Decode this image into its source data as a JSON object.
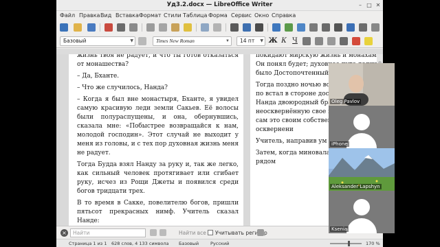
{
  "window": {
    "title": "Уд3.2.docx — LibreOffice Writer"
  },
  "menu": [
    "Файл",
    "Правка",
    "Вид",
    "Вставка",
    "Формат",
    "Стили",
    "Таблица",
    "Форма",
    "Сервис",
    "Окно",
    "Справка"
  ],
  "toolbar": {
    "paragraph_style": "Базовый",
    "font_name": "Times New Roman",
    "font_size": "14 пт",
    "bold_label": "Ж",
    "italic_label": "К",
    "underline_label": "Ч"
  },
  "document": {
    "page1": [
      "жизнь твоя не радует, и что ты готов отказаться от монашества?",
      "– Да, Бханте.",
      "– Что же случилось, Нанда?",
      "– Когда я был вне монастыря, Бханте, я увидел самую красивую леди земли Сакьев. Её волосы были полураспущены, и она, обернувшись, сказала мне: «Побыстрее возвращайся к нам, молодой господин». Этот случай не выходит у меня из головы, и с тех пор духовная жизнь меня не радует.",
      "Тогда Будда взял Нанду за руку и, так же легко, как сильный человек протягивает или сгибает руку, исчез из Рощи Джеты и появился среди богов тридцати трех.",
      "В то время в Сакке, повелителю богов, пришли пятьсот прекрасных нимф. Учитель сказал Нанде:"
    ],
    "page2": [
      "покидают мирскую жизнь и монахами. Он понял будет; духовное путе должно было Достопочтенный Нанда",
      "Тогда поздно ночью всю рощу Джеты, по встал в стороне достопочтенный Нанда двоюродный брат неосквернённую свое мудростью в этой сам это своим собственным окончанию осквернени",
      "Учитель, направив ум к",
      "Затем, когда миновала поклонился, сел рядом"
    ]
  },
  "findbar": {
    "placeholder": "Найти",
    "find_all": "Найти все",
    "match_case": "Учитывать регистр"
  },
  "statusbar": {
    "page": "Страница 1 из 1",
    "words": "628 слов, 4 133 символа",
    "style": "Базовый",
    "language": "Русский",
    "zoom": "170 %"
  },
  "participants": [
    {
      "name": "Oleg Pavlov",
      "kind": "video"
    },
    {
      "name": "iPhone",
      "kind": "avatar"
    },
    {
      "name": "Aleksander Lapshyn",
      "kind": "landscape"
    },
    {
      "name": "Ksenia",
      "kind": "avatar"
    }
  ]
}
